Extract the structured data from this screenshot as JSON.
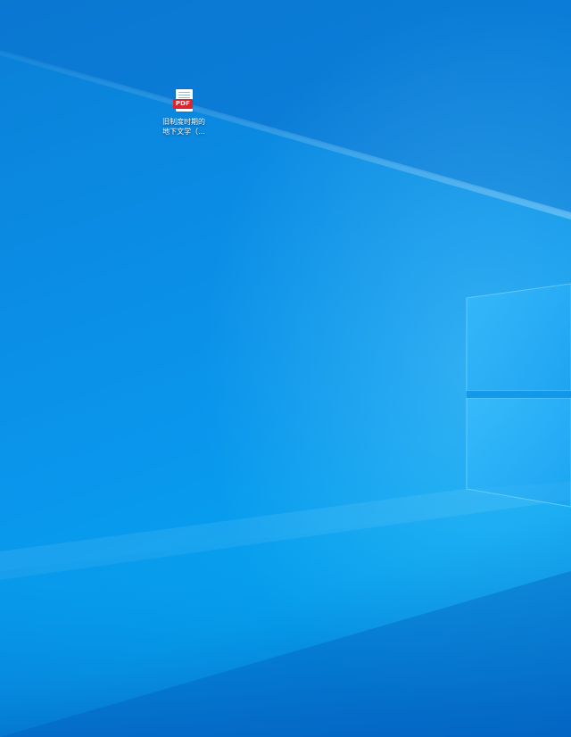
{
  "desktop": {
    "background_colors": {
      "primary": "#0997ec",
      "dark": "#0a6fcc",
      "light": "#19b4f5"
    },
    "wallpaper_logo": "windows-logo"
  },
  "icons": [
    {
      "type": "pdf-file-icon",
      "badge": "PDF",
      "caption_line1": "旧制度时期的",
      "caption_line2": "地下文学（..."
    }
  ]
}
